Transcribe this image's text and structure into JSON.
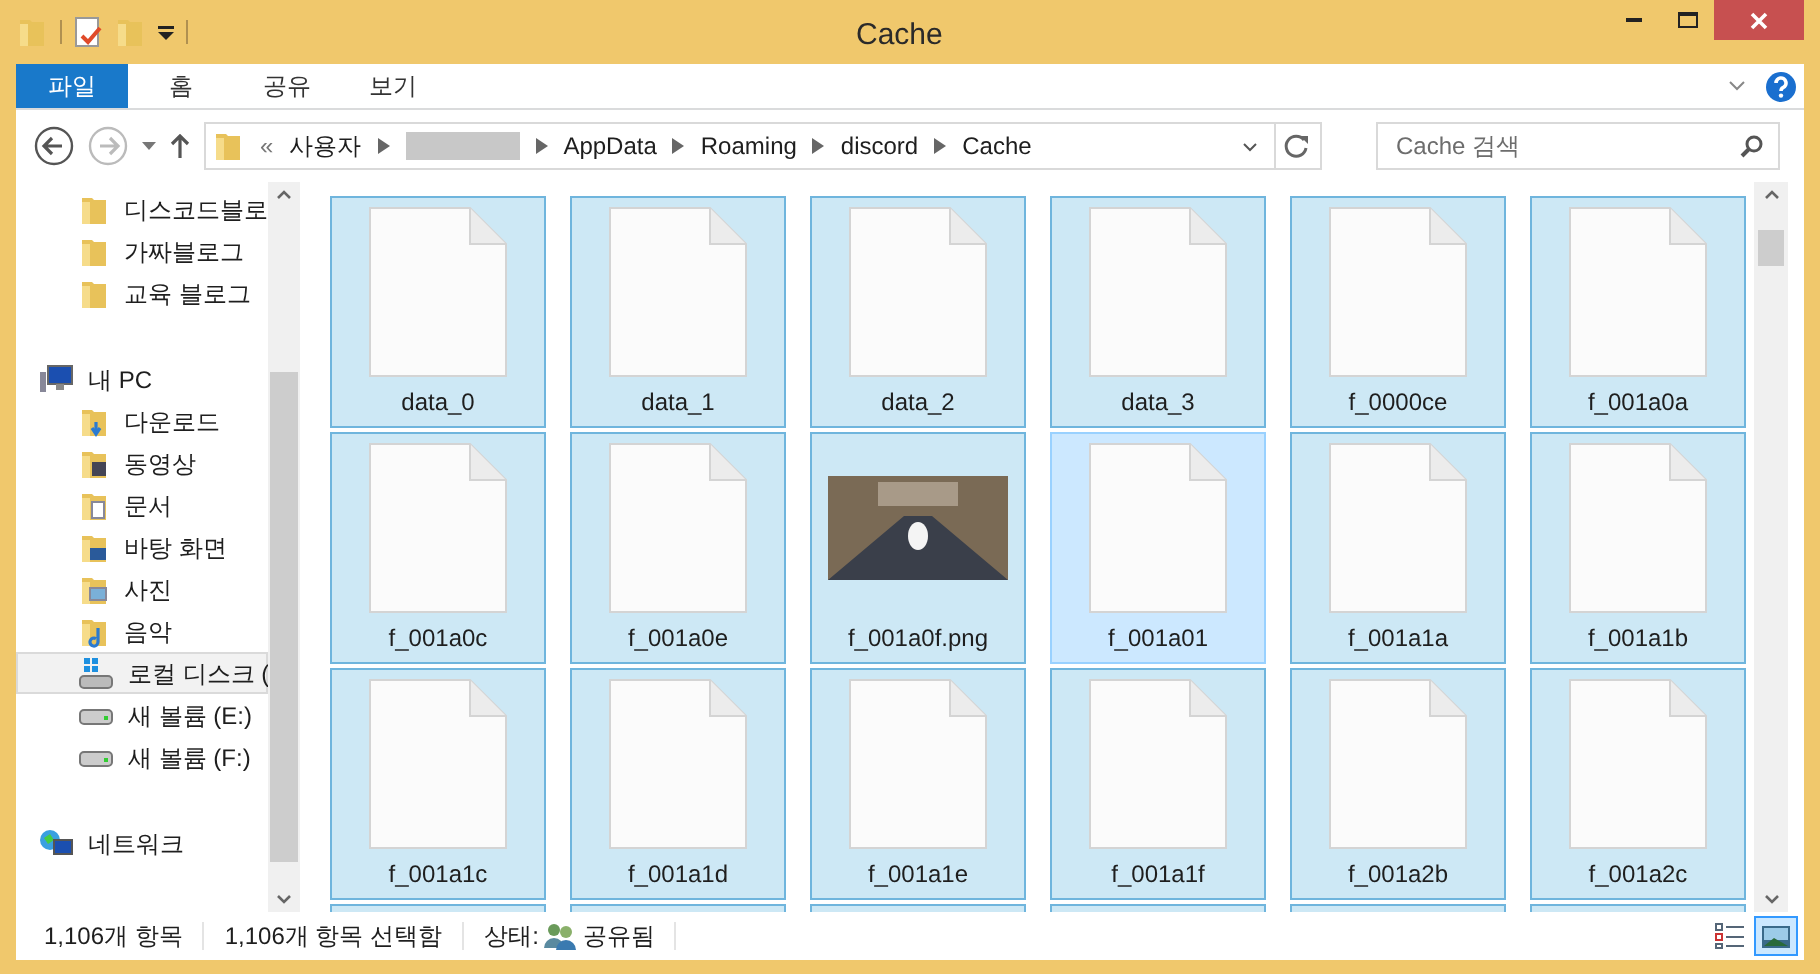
{
  "window": {
    "title": "Cache"
  },
  "ribbon_tabs": [
    {
      "label": "파일",
      "selected": true
    },
    {
      "label": "홈",
      "selected": false
    },
    {
      "label": "공유",
      "selected": false
    },
    {
      "label": "보기",
      "selected": false
    }
  ],
  "address": {
    "prefix": "«",
    "segments": [
      {
        "kind": "text",
        "label": "사용자"
      },
      {
        "kind": "redacted"
      },
      {
        "kind": "text",
        "label": "AppData"
      },
      {
        "kind": "text",
        "label": "Roaming"
      },
      {
        "kind": "text",
        "label": "discord"
      },
      {
        "kind": "text",
        "label": "Cache"
      }
    ]
  },
  "search": {
    "placeholder": "Cache 검색"
  },
  "sidebar": {
    "items": [
      {
        "kind": "folder",
        "label": "디스코드블로"
      },
      {
        "kind": "folder",
        "label": "가짜블로그"
      },
      {
        "kind": "folder",
        "label": "교육 블로그"
      },
      {
        "kind": "gap"
      },
      {
        "kind": "pc",
        "label": "내 PC",
        "children": [
          {
            "kind": "downloads",
            "label": "다운로드",
            "selected": false
          },
          {
            "kind": "videos",
            "label": "동영상",
            "selected": false
          },
          {
            "kind": "documents",
            "label": "문서",
            "selected": false
          },
          {
            "kind": "desktop",
            "label": "바탕 화면",
            "selected": false
          },
          {
            "kind": "pictures",
            "label": "사진",
            "selected": false
          },
          {
            "kind": "music",
            "label": "음악",
            "selected": false
          },
          {
            "kind": "system-drive",
            "label": "로컬 디스크 (",
            "selected": true
          },
          {
            "kind": "drive",
            "label": "새 볼륨 (E:)",
            "selected": false
          },
          {
            "kind": "drive",
            "label": "새 볼륨 (F:)",
            "selected": false
          }
        ]
      },
      {
        "kind": "gap"
      },
      {
        "kind": "network",
        "label": "네트워크"
      }
    ]
  },
  "files": [
    {
      "kind": "file",
      "name": "data_0",
      "selected": true,
      "focused": false
    },
    {
      "kind": "file",
      "name": "data_1",
      "selected": true,
      "focused": false
    },
    {
      "kind": "file",
      "name": "data_2",
      "selected": true,
      "focused": false
    },
    {
      "kind": "file",
      "name": "data_3",
      "selected": true,
      "focused": false
    },
    {
      "kind": "file",
      "name": "f_0000ce",
      "selected": true,
      "focused": false
    },
    {
      "kind": "file",
      "name": "f_001a0a",
      "selected": true,
      "focused": false
    },
    {
      "kind": "file",
      "name": "f_001a0c",
      "selected": true,
      "focused": false
    },
    {
      "kind": "file",
      "name": "f_001a0e",
      "selected": true,
      "focused": false
    },
    {
      "kind": "image",
      "name": "f_001a0f.png",
      "selected": true,
      "focused": false
    },
    {
      "kind": "file",
      "name": "f_001a01",
      "selected": true,
      "focused": true
    },
    {
      "kind": "file",
      "name": "f_001a1a",
      "selected": true,
      "focused": false
    },
    {
      "kind": "file",
      "name": "f_001a1b",
      "selected": true,
      "focused": false
    },
    {
      "kind": "file",
      "name": "f_001a1c",
      "selected": true,
      "focused": false
    },
    {
      "kind": "file",
      "name": "f_001a1d",
      "selected": true,
      "focused": false
    },
    {
      "kind": "file",
      "name": "f_001a1e",
      "selected": true,
      "focused": false
    },
    {
      "kind": "file",
      "name": "f_001a1f",
      "selected": true,
      "focused": false
    },
    {
      "kind": "file",
      "name": "f_001a2b",
      "selected": true,
      "focused": false
    },
    {
      "kind": "file",
      "name": "f_001a2c",
      "selected": true,
      "focused": false
    }
  ],
  "status_bar": {
    "item_count": "1,106개 항목",
    "selection": "1,106개 항목 선택함",
    "state_label": "상태:",
    "state_value": "공유됨"
  }
}
